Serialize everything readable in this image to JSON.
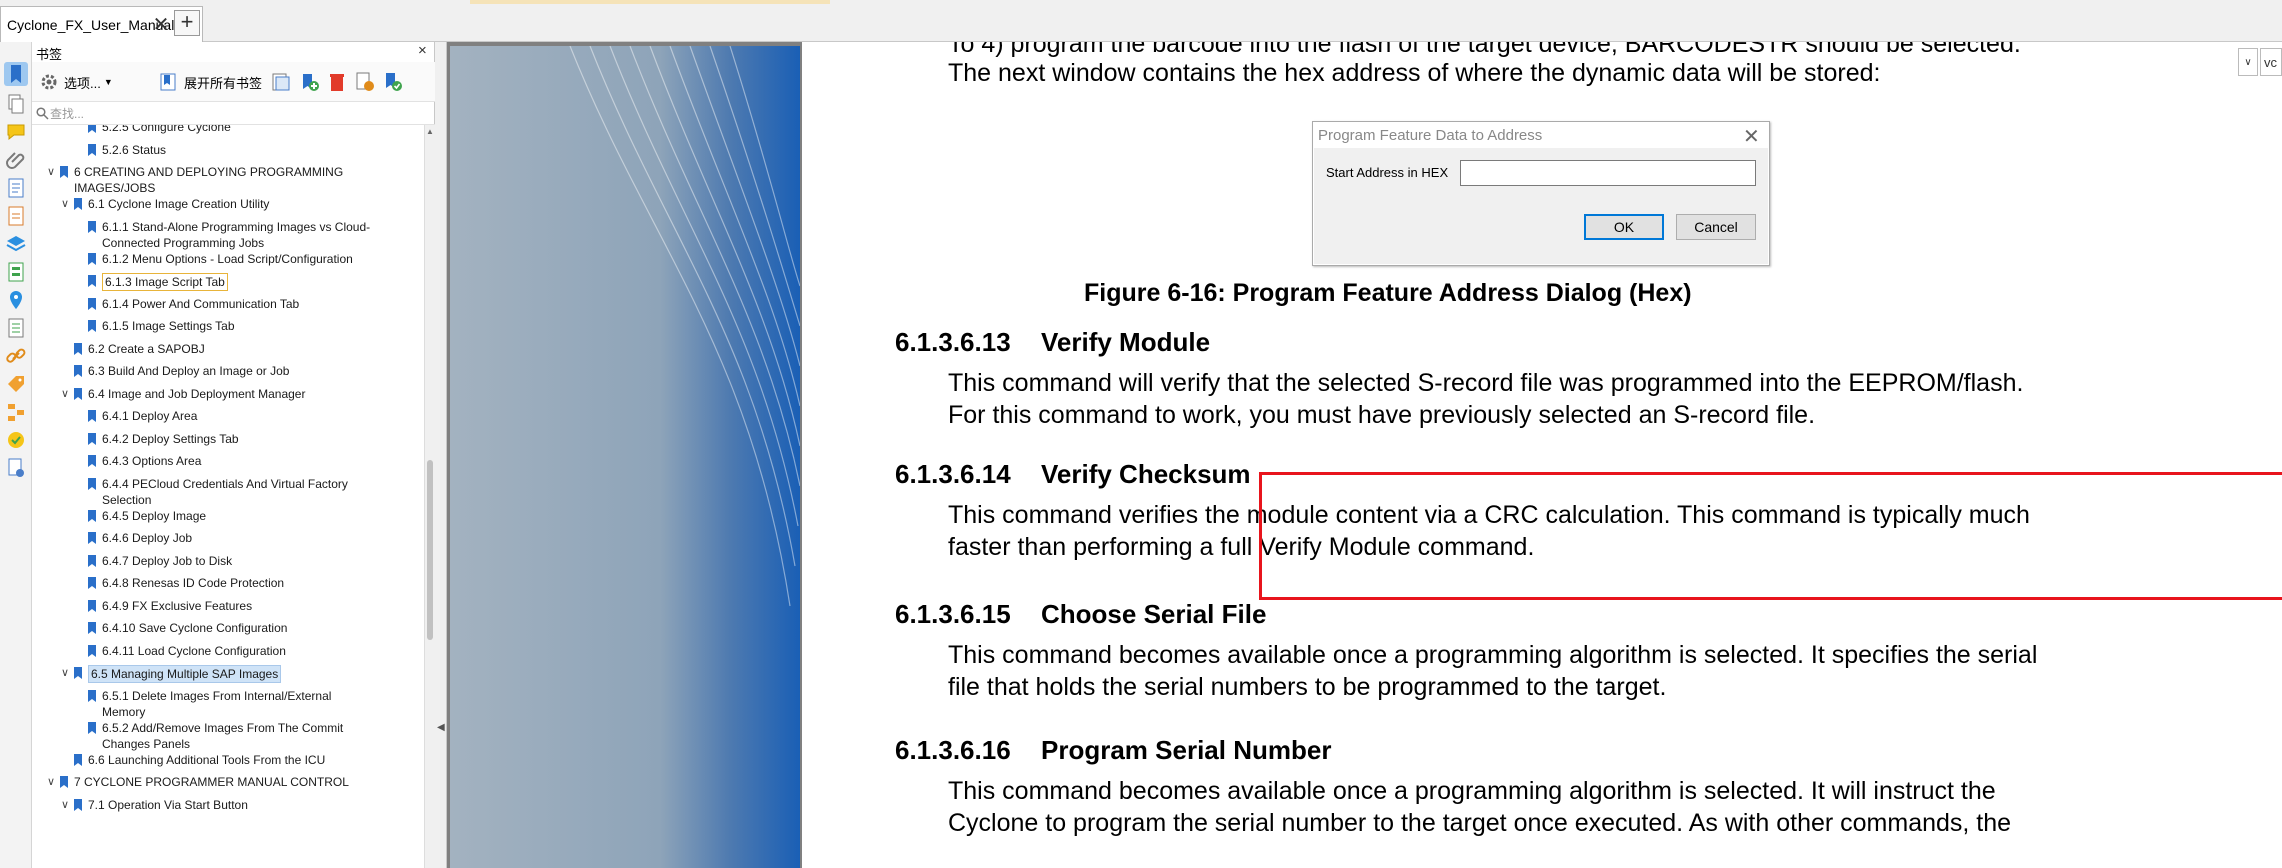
{
  "tabbar": {
    "doc_tab_label": "Cyclone_FX_User_Manual",
    "close_glyph": "✕",
    "add_glyph": "+"
  },
  "bookmarks": {
    "title": "书签",
    "close_glyph": "×",
    "toolbar": {
      "options_label": "选项...",
      "expand_all_label": "展开所有书签"
    },
    "search_placeholder": "查找...",
    "items": [
      {
        "label": "5.2.5 Configure Cyclone",
        "toggle": "",
        "indent": 2
      },
      {
        "label": "5.2.6 Status",
        "toggle": "",
        "indent": 2
      },
      {
        "label": "6 CREATING AND DEPLOYING PROGRAMMING IMAGES/JOBS",
        "toggle": "∨",
        "indent": 0
      },
      {
        "label": "6.1 Cyclone Image Creation Utility",
        "toggle": "∨",
        "indent": 1
      },
      {
        "label": "6.1.1 Stand-Alone Programming Images vs Cloud-Connected Programming Jobs",
        "toggle": "",
        "indent": 2
      },
      {
        "label": "6.1.2 Menu Options - Load Script/Configuration",
        "toggle": "",
        "indent": 2
      },
      {
        "label": "6.1.3 Image Script Tab",
        "toggle": "",
        "indent": 2
      },
      {
        "label": "6.1.4 Power And Communication Tab",
        "toggle": "",
        "indent": 2
      },
      {
        "label": "6.1.5 Image Settings Tab",
        "toggle": "",
        "indent": 2
      },
      {
        "label": "6.2 Create a SAPOBJ",
        "toggle": "",
        "indent": 1
      },
      {
        "label": "6.3 Build And Deploy an Image or Job",
        "toggle": "",
        "indent": 1
      },
      {
        "label": "6.4 Image and Job Deployment Manager",
        "toggle": "∨",
        "indent": 1
      },
      {
        "label": "6.4.1 Deploy Area",
        "toggle": "",
        "indent": 2
      },
      {
        "label": "6.4.2 Deploy Settings Tab",
        "toggle": "",
        "indent": 2
      },
      {
        "label": "6.4.3 Options Area",
        "toggle": "",
        "indent": 2
      },
      {
        "label": "6.4.4 PECloud Credentials And Virtual Factory Selection",
        "toggle": "",
        "indent": 2
      },
      {
        "label": "6.4.5 Deploy Image",
        "toggle": "",
        "indent": 2
      },
      {
        "label": "6.4.6 Deploy Job",
        "toggle": "",
        "indent": 2
      },
      {
        "label": "6.4.7 Deploy Job to Disk",
        "toggle": "",
        "indent": 2
      },
      {
        "label": "6.4.8 Renesas ID Code Protection",
        "toggle": "",
        "indent": 2
      },
      {
        "label": "6.4.9 FX Exclusive Features",
        "toggle": "",
        "indent": 2
      },
      {
        "label": "6.4.10 Save Cyclone Configuration",
        "toggle": "",
        "indent": 2
      },
      {
        "label": "6.4.11 Load Cyclone Configuration",
        "toggle": "",
        "indent": 2
      },
      {
        "label": "6.5 Managing Multiple SAP Images",
        "toggle": "∨",
        "indent": 1
      },
      {
        "label": "6.5.1 Delete Images From Internal/External Memory",
        "toggle": "",
        "indent": 2
      },
      {
        "label": "6.5.2 Add/Remove Images From The Commit Changes Panels",
        "toggle": "",
        "indent": 2
      },
      {
        "label": "6.6 Launching Additional Tools From the ICU",
        "toggle": "",
        "indent": 1
      },
      {
        "label": "7 CYCLONE PROGRAMMER MANUAL CONTROL",
        "toggle": "∨",
        "indent": 0
      },
      {
        "label": "7.1 Operation Via Start Button",
        "toggle": "∨",
        "indent": 1
      }
    ]
  },
  "document": {
    "line_top_partial": "To 4) program the barcode into the flash of the target device, BARCODESTR should be selected.",
    "line_next_window": "The next window contains the hex address of where the dynamic data will be stored:",
    "dialog": {
      "title": "Program Feature Data to Address",
      "close_glyph": "✕",
      "field_label": "Start Address in HEX",
      "field_value": "",
      "ok_label": "OK",
      "cancel_label": "Cancel"
    },
    "figure_caption": "Figure 6-16: Program Feature Address Dialog (Hex)",
    "sections": [
      {
        "number": "6.1.3.6.13",
        "title": "Verify Module",
        "lines": [
          "This command will verify that the selected S-record file was programmed into the EEPROM/flash.",
          "For this command to work, you must have previously selected an S-record file."
        ]
      },
      {
        "number": "6.1.3.6.14",
        "title": "Verify Checksum",
        "lines": [
          "This command verifies the module content via a CRC calculation. This command is typically much",
          "faster than performing a full Verify Module command."
        ]
      },
      {
        "number": "6.1.3.6.15",
        "title": "Choose Serial File",
        "lines": [
          "This command becomes available once a programming algorithm is selected. It specifies the serial",
          "file that holds the serial numbers to be programmed to the target."
        ]
      },
      {
        "number": "6.1.3.6.16",
        "title": "Program Serial Number",
        "lines": [
          "This command becomes available once a programming algorithm is selected. It will instruct the",
          "Cyclone to program the serial number to the target once executed. As with other commands, the"
        ]
      }
    ]
  },
  "zoom": {
    "label": "vc",
    "chevron": "∨"
  },
  "colors": {
    "highlight_border": "#e8141c",
    "selected_bookmark_bg": "#cfe3f7",
    "bookmark_flag": "#2a6fc9"
  }
}
